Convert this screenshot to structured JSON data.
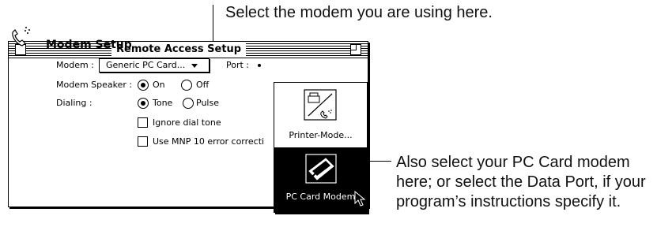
{
  "callouts": {
    "top": "Select the modem you are using here.",
    "right": "Also select your PC Card modem here; or select the Data Port, if your program’s instructions specify it."
  },
  "window": {
    "title": "Remote Access Setup"
  },
  "section": {
    "title": "Modem Setup"
  },
  "modem": {
    "label": "Modem :",
    "value": "Generic PC Card..."
  },
  "port": {
    "label": "Port :",
    "items": [
      {
        "label": "Printer-Mode...",
        "icon": "printer-modem-icon",
        "selected": false
      },
      {
        "label": "PC Card Modem",
        "icon": "pc-card-modem-icon",
        "selected": true
      }
    ]
  },
  "speaker": {
    "label": "Modem Speaker :",
    "on": "On",
    "off": "Off",
    "selected": "On"
  },
  "dialing": {
    "label": "Dialing :",
    "tone": "Tone",
    "pulse": "Pulse",
    "selected": "Tone"
  },
  "options": {
    "ignore_dial_tone": "Ignore dial tone",
    "mnp10": "Use MNP 10 error correcti"
  }
}
